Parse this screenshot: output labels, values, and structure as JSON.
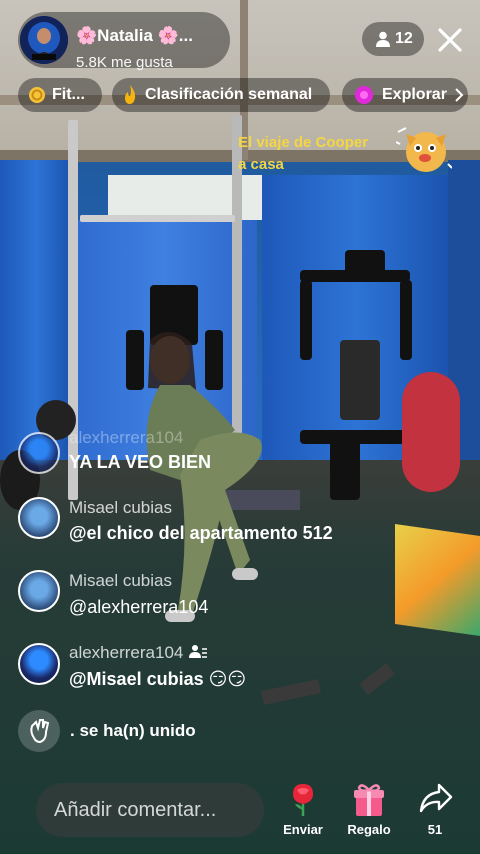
{
  "host": {
    "name": "🌸Natalia 🌸...",
    "likes": "5.8K me gusta",
    "viewers": "12"
  },
  "chips": [
    {
      "label": "Fit...",
      "icon": "coin-icon"
    },
    {
      "label": "Clasificación semanal",
      "icon": "flame-icon"
    },
    {
      "label": "Explorar",
      "icon": "explore-icon"
    }
  ],
  "promo": {
    "line1": "El viaje de Cooper",
    "line2": "a casa"
  },
  "comments": [
    {
      "user": "alexherrera104",
      "text": "YA LA VEO BIEN"
    },
    {
      "user": "Misael cubias",
      "text": "@el chico del apartamento 512"
    },
    {
      "user": "Misael cubias",
      "text": "@alexherrera104"
    },
    {
      "user": "alexherrera104",
      "text": "@Misael cubias 😏😏"
    }
  ],
  "joined": ". se ha(n) unido",
  "input": {
    "placeholder": "Añadir comentar..."
  },
  "actions": {
    "send": "Enviar",
    "gift": "Regalo",
    "share_count": "51"
  }
}
